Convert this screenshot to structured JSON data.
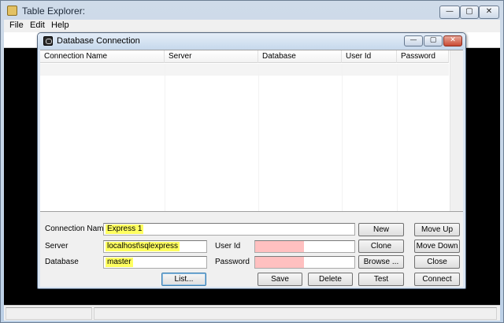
{
  "main_window": {
    "title": "Table Explorer:",
    "controls": {
      "minimize": "—",
      "maximize": "▢",
      "close": "✕"
    },
    "menu": [
      "File",
      "Edit",
      "Help"
    ]
  },
  "dialog": {
    "title": "Database Connection",
    "controls": {
      "minimize": "—",
      "maximize": "▢",
      "close": "✕"
    },
    "grid": {
      "columns": [
        "Connection Name",
        "Server",
        "Database",
        "User Id",
        "Password"
      ],
      "rows": []
    },
    "form": {
      "connection_name_label": "Connection Name",
      "connection_name_value": "Express 1",
      "server_label": "Server",
      "server_value": "localhost\\sqlexpress",
      "database_label": "Database",
      "database_value": "master",
      "user_id_label": "User Id",
      "user_id_value": "",
      "password_label": "Password",
      "password_value": ""
    },
    "buttons": {
      "list": "List...",
      "save": "Save",
      "delete": "Delete",
      "new": "New",
      "clone": "Clone",
      "browse": "Browse ...",
      "test": "Test",
      "move_up": "Move Up",
      "move_down": "Move Down",
      "close": "Close",
      "connect": "Connect"
    },
    "colors": {
      "required_highlight": "#ffff60",
      "invalid_highlight": "#ffc0c0"
    }
  }
}
